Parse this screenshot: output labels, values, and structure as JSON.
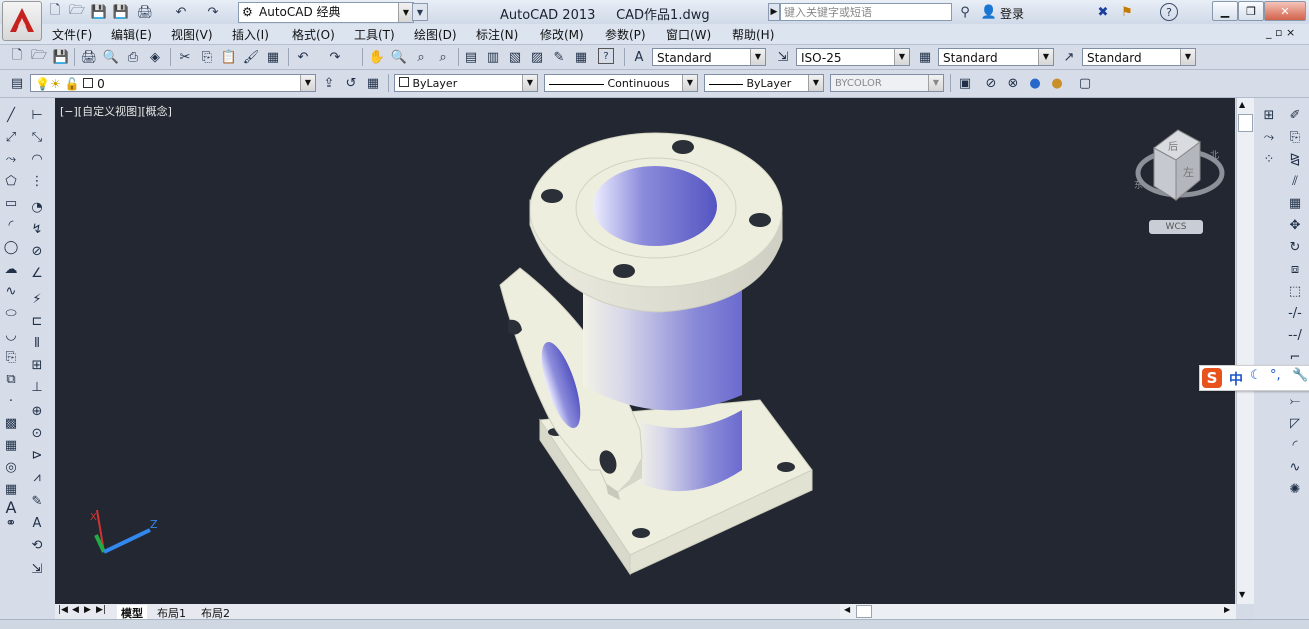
{
  "title_bar": {
    "workspace": "AutoCAD 经典",
    "app_name": "AutoCAD 2013",
    "file_name": "CAD作品1.dwg",
    "search_placeholder": "键入关键字或短语",
    "login": "登录"
  },
  "menu": [
    "文件(F)",
    "编辑(E)",
    "视图(V)",
    "插入(I)",
    "格式(O)",
    "工具(T)",
    "绘图(D)",
    "标注(N)",
    "修改(M)",
    "参数(P)",
    "窗口(W)",
    "帮助(H)"
  ],
  "styles_toolbar": {
    "text_style": "Standard",
    "dim_style": "ISO-25",
    "table_style": "Standard",
    "multileader_style": "Standard"
  },
  "layers_toolbar": {
    "layer": "0",
    "color": "ByLayer",
    "linetype": "Continuous",
    "lineweight": "ByLayer",
    "plot_style": "BYCOLOR"
  },
  "viewport": {
    "label": "[−][自定义视图][概念]",
    "navcube_top": "后",
    "navcube_front": "左",
    "compass_labels": [
      "东",
      "北"
    ],
    "wcs_label": "WCS"
  },
  "ucs": {
    "x": "X",
    "z": "Z"
  },
  "tabs": [
    "模型",
    "布局1",
    "布局2"
  ],
  "ime": {
    "name": "中"
  },
  "colors": {
    "canvas": "#222731",
    "model_face": "#eeeede",
    "model_shade": "#6f6fd4",
    "ucs_x": "#d33333",
    "ucs_y": "#22aa44",
    "ucs_z": "#3388ee"
  }
}
